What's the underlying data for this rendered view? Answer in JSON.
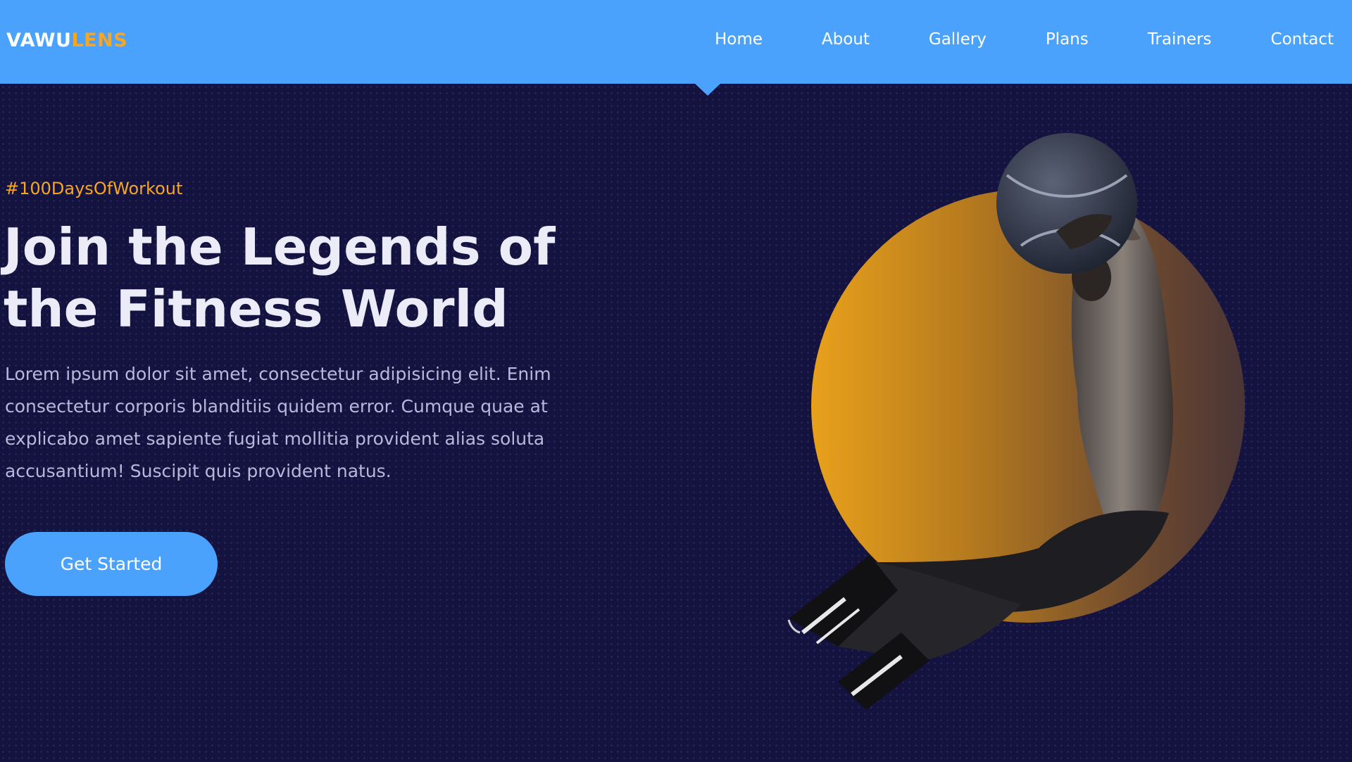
{
  "brand": {
    "primary": "VAWU",
    "accent": "LENS"
  },
  "nav": {
    "items": [
      {
        "label": "Home"
      },
      {
        "label": "About"
      },
      {
        "label": "Gallery"
      },
      {
        "label": "Plans"
      },
      {
        "label": "Trainers"
      },
      {
        "label": "Contact"
      }
    ],
    "active": "Home"
  },
  "hero": {
    "tagline": "#100DaysOfWorkout",
    "headline_line1": "Join the Legends of",
    "headline_line2": "the Fitness World",
    "description": "Lorem ipsum dolor sit amet, consectetur adipisicing elit. Enim consectetur corporis blanditiis quidem error. Cumque quae at explicabo amet sapiente fugiat mollitia provident alias soluta accusantium! Suscipit quis provident natus.",
    "cta_label": "Get Started"
  },
  "colors": {
    "nav_background": "#4aa2fc",
    "page_background": "#14133f",
    "accent": "#f6a623",
    "headline": "#ecebf8",
    "body_text": "#b9b8dc"
  }
}
